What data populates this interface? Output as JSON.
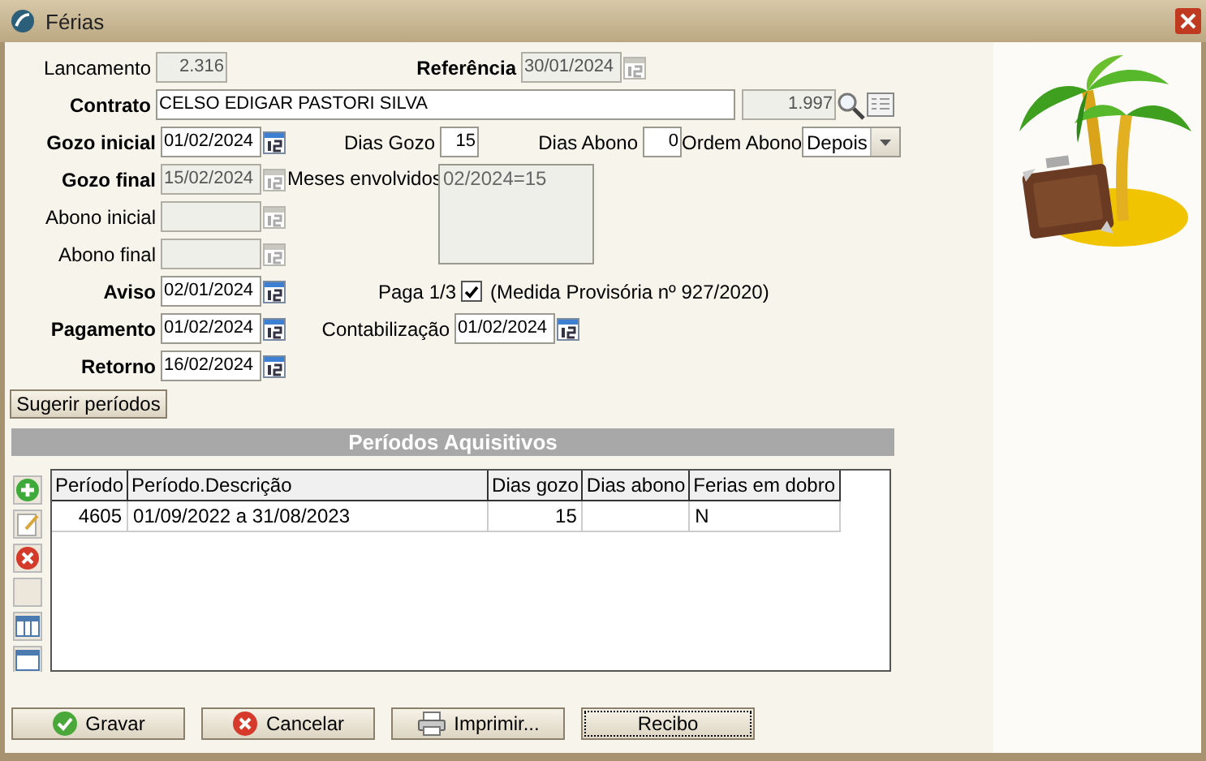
{
  "window": {
    "title": "Férias"
  },
  "lancamento": {
    "label": "Lancamento",
    "value": "2.316",
    "disabled": true,
    "required": false
  },
  "referencia": {
    "label": "Referência",
    "value": "30/01/2024",
    "disabled": true,
    "required": true
  },
  "contrato": {
    "label": "Contrato",
    "value": "CELSO EDIGAR PASTORI SILVA",
    "code": "1.997",
    "required": true
  },
  "gozo_inicial": {
    "label": "Gozo inicial",
    "value": "01/02/2024",
    "disabled": false,
    "required": true
  },
  "dias_gozo": {
    "label": "Dias Gozo",
    "value": "15"
  },
  "dias_abono": {
    "label": "Dias Abono",
    "value": "0"
  },
  "ordem_abono": {
    "label": "Ordem Abono",
    "value": "Depois"
  },
  "gozo_final": {
    "label": "Gozo final",
    "value": "15/02/2024",
    "disabled": true,
    "required": true
  },
  "meses_envolvidos": {
    "label": "Meses envolvidos",
    "value": "02/2024=15"
  },
  "abono_inicial": {
    "label": "Abono inicial",
    "disabled": true,
    "required": false
  },
  "abono_final": {
    "label": "Abono final",
    "disabled": true,
    "required": false
  },
  "aviso": {
    "label": "Aviso",
    "value": "02/01/2024",
    "disabled": false,
    "required": true
  },
  "paga_terco": {
    "label": "Paga 1/3",
    "checked": true,
    "note": "(Medida Provisória nº 927/2020)"
  },
  "pagamento": {
    "label": "Pagamento",
    "value": "01/02/2024",
    "disabled": false,
    "required": true
  },
  "contabilizacao": {
    "label": "Contabilização",
    "value": "01/02/2024",
    "disabled": false,
    "required": false
  },
  "retorno": {
    "label": "Retorno",
    "value": "16/02/2024",
    "disabled": false,
    "required": true
  },
  "suggest_button": "Sugerir períodos",
  "periods": {
    "title": "Períodos Aquisitivos",
    "columns": [
      "Período",
      "Período.Descrição",
      "Dias gozo",
      "Dias abono",
      "Ferias em dobro"
    ],
    "rows": [
      [
        "4605",
        "01/09/2022 a 31/08/2023",
        "15",
        null,
        "N"
      ]
    ]
  },
  "buttons": [
    {
      "label": "Gravar",
      "kind": "save",
      "focused": false
    },
    {
      "label": "Cancelar",
      "kind": "cancel",
      "focused": false
    },
    {
      "label": "Imprimir...",
      "kind": "print",
      "focused": false
    },
    {
      "label": "Recibo",
      "kind": "plain",
      "focused": true
    }
  ]
}
